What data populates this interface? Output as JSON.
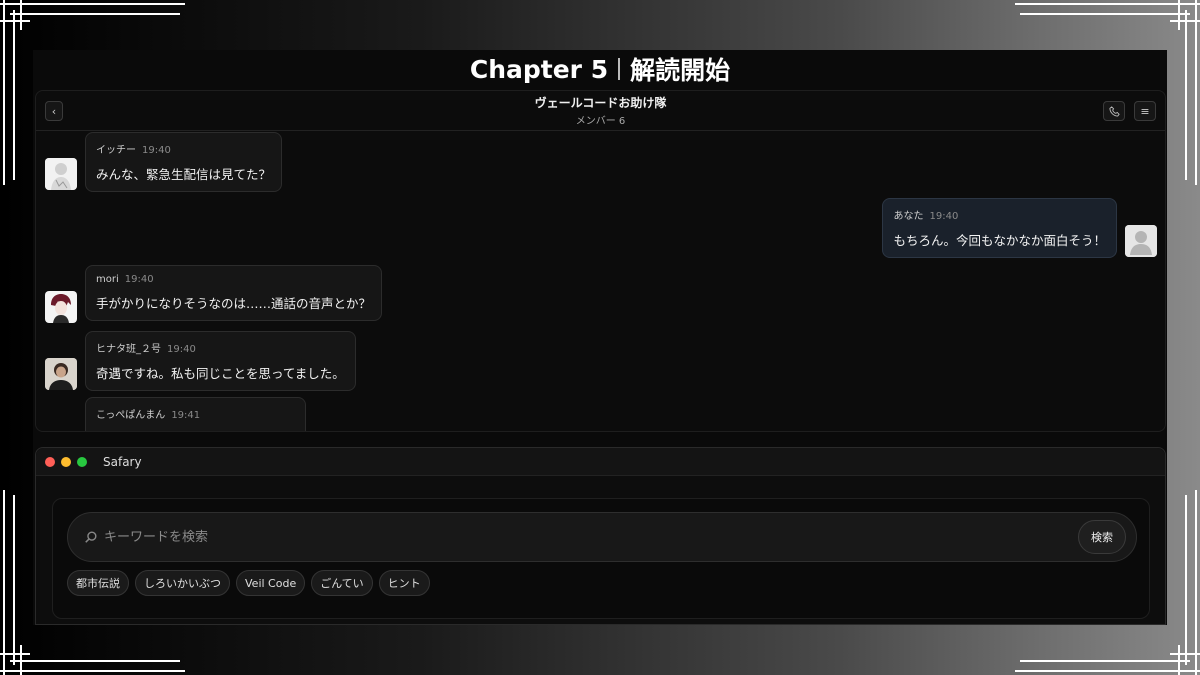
{
  "page": {
    "title_en": "Chapter 5",
    "title_jp": "解読開始"
  },
  "chat": {
    "name": "ヴェールコードお助け隊",
    "members": "メンバー 6",
    "back_icon": "‹",
    "call_icon": "📞",
    "menu_icon": "≡",
    "messages": [
      {
        "sender": "イッチー",
        "time": "19:40",
        "text": "みんな、緊急生配信は見てた？",
        "side": "left"
      },
      {
        "sender": "あなた",
        "time": "19:40",
        "text": "もちろん。今回もなかなか面白そう！",
        "side": "right"
      },
      {
        "sender": "mori",
        "time": "19:40",
        "text": "手がかりになりそうなのは……通話の音声とか？",
        "side": "left"
      },
      {
        "sender": "ヒナタ班_２号",
        "time": "19:40",
        "text": "奇遇ですね。私も同じことを思ってました。",
        "side": "left"
      },
      {
        "sender": "こっぺぱんまん",
        "time": "19:41",
        "text": "",
        "side": "left"
      }
    ]
  },
  "browser": {
    "title": "Safary",
    "search_placeholder": "キーワードを検索",
    "search_button": "検索",
    "tags": [
      "都市伝説",
      "しろいかいぶつ",
      "Veil Code",
      "ごんてい",
      "ヒント"
    ]
  },
  "colors": {
    "close": "#ff5f57",
    "minimize": "#febc2e",
    "zoom": "#28c840"
  }
}
